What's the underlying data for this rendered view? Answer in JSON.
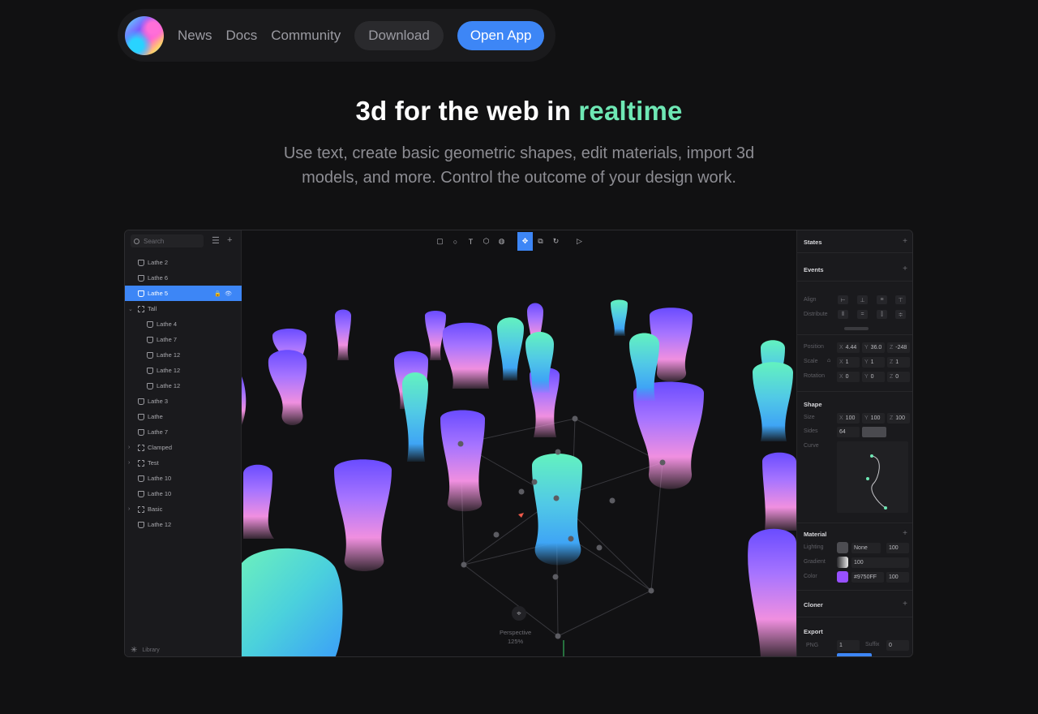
{
  "nav": {
    "links": [
      "News",
      "Docs",
      "Community"
    ],
    "download_label": "Download",
    "open_app_label": "Open App"
  },
  "hero": {
    "title_prefix": "3d for the web in ",
    "title_accent": "realtime",
    "subtitle": "Use text, create basic geometric shapes, edit materials, import 3d models, and more. Control the outcome of your design work."
  },
  "app": {
    "search_placeholder": "Search",
    "tree": [
      {
        "label": "Lathe 2",
        "indent": 1,
        "group": false,
        "selected": false
      },
      {
        "label": "Lathe 6",
        "indent": 1,
        "group": false,
        "selected": false
      },
      {
        "label": "Lathe 5",
        "indent": 1,
        "group": false,
        "selected": true
      },
      {
        "label": "Tall",
        "indent": 1,
        "group": true,
        "expanded": true,
        "selected": false
      },
      {
        "label": "Lathe 4",
        "indent": 2,
        "group": false,
        "selected": false
      },
      {
        "label": "Lathe 7",
        "indent": 2,
        "group": false,
        "selected": false
      },
      {
        "label": "Lathe 12",
        "indent": 2,
        "group": false,
        "selected": false
      },
      {
        "label": "Lathe 12",
        "indent": 2,
        "group": false,
        "selected": false
      },
      {
        "label": "Lathe 12",
        "indent": 2,
        "group": false,
        "selected": false
      },
      {
        "label": "Lathe 3",
        "indent": 1,
        "group": false,
        "selected": false
      },
      {
        "label": "Lathe",
        "indent": 1,
        "group": false,
        "selected": false
      },
      {
        "label": "Lathe 7",
        "indent": 1,
        "group": false,
        "selected": false
      },
      {
        "label": "Clamped",
        "indent": 1,
        "group": true,
        "expanded": false,
        "selected": false
      },
      {
        "label": "Test",
        "indent": 1,
        "group": true,
        "expanded": false,
        "selected": false
      },
      {
        "label": "Lathe 10",
        "indent": 1,
        "group": false,
        "selected": false
      },
      {
        "label": "Lathe 10",
        "indent": 1,
        "group": false,
        "selected": false
      },
      {
        "label": "Basic",
        "indent": 1,
        "group": true,
        "expanded": false,
        "selected": false
      },
      {
        "label": "Lathe 12",
        "indent": 1,
        "group": false,
        "selected": false
      }
    ],
    "library_label": "Library",
    "viewport": {
      "camera_label": "Perspective",
      "zoom": "125%"
    },
    "inspector": {
      "states": "States",
      "events": "Events",
      "align": "Align",
      "distribute": "Distribute",
      "position_label": "Position",
      "position": {
        "x": "4.44",
        "y": "36.0",
        "z": "-248"
      },
      "scale_label": "Scale",
      "scale": {
        "x": "1",
        "y": "1",
        "z": "1"
      },
      "rotation_label": "Rotation",
      "rotation": {
        "x": "0",
        "y": "0",
        "z": "0"
      },
      "shape": "Shape",
      "size_label": "Size",
      "size": {
        "x": "100",
        "y": "100",
        "z": "100"
      },
      "sides_label": "Sides",
      "sides": "64",
      "curve_label": "Curve",
      "material": "Material",
      "lighting_label": "Lighting",
      "lighting_value": "None",
      "lighting_opacity": "100",
      "gradient_label": "Gradient",
      "gradient_value": "100",
      "color_label": "Color",
      "color_hex": "#9750FF",
      "color_opacity": "100",
      "color_swatch": "#9750ff",
      "cloner": "Cloner",
      "export": "Export",
      "export_format": "PNG",
      "export_scale": "1",
      "suffix_label": "Suffix",
      "suffix_value": "0"
    }
  },
  "colors": {
    "accent_blue": "#3d86f6",
    "accent_green": "#6ee7b4"
  }
}
